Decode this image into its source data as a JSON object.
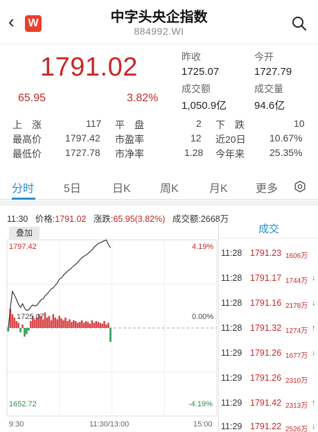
{
  "header": {
    "back_icon": "chevron-left-icon",
    "logo_text": "W",
    "title": "中字头央企指数",
    "code": "884992.WI",
    "search_icon": "search-icon"
  },
  "quote": {
    "price": "1791.02",
    "change": "65.95",
    "change_pct": "3.82%",
    "prev_close_label": "昨收",
    "prev_close": "1725.07",
    "open_label": "今开",
    "open": "1727.79",
    "turnover_label": "成交额",
    "turnover": "1,050.9亿",
    "volume_label": "成交量",
    "volume": "94.6亿"
  },
  "stats": {
    "rising_label": "上　涨",
    "rising": "117",
    "flat_label": "平　盘",
    "flat": "2",
    "falling_label": "下　跌",
    "falling": "10",
    "high_label": "最高价",
    "high": "1797.42",
    "pe_label": "市盈率",
    "pe": "12",
    "chg20_label": "近20日",
    "chg20": "10.67%",
    "low_label": "最低价",
    "low": "1727.78",
    "pb_label": "市净率",
    "pb": "1.28",
    "ytd_label": "今年来",
    "ytd": "25.35%"
  },
  "tabs": [
    {
      "label": "分时",
      "active": true
    },
    {
      "label": "5日"
    },
    {
      "label": "日K"
    },
    {
      "label": "周K"
    },
    {
      "label": "月K"
    },
    {
      "label": "更多"
    }
  ],
  "tabs_settings_icon": "settings-hexagon-icon",
  "info_line": {
    "time": "11:30",
    "price_label": "价格:",
    "price": "1791.02",
    "change_label": "涨跌:",
    "change": "65.95(3.82%)",
    "turnover_label": "成交额:",
    "turnover": "2668万"
  },
  "chart": {
    "overlay_label": "叠加",
    "max_price": "1797.42",
    "max_pct": "4.19%",
    "base_price": "1725.07",
    "base_pct": "0.00%",
    "min_price": "1652.72",
    "min_pct": "-4.19%",
    "time_start": "9:30",
    "time_mid": "11:30/13:00",
    "time_end": "15:00"
  },
  "chart_data": {
    "type": "line",
    "y_range": [
      1652.72,
      1797.42
    ],
    "baseline": 1725.07,
    "price_series": [
      1725.07,
      1741.5,
      1755.2,
      1752.0,
      1748.5,
      1744.3,
      1742.0,
      1745.0,
      1741.2,
      1739.5,
      1740.1,
      1742.6,
      1744.0,
      1743.1,
      1743.8,
      1746.0,
      1748.2,
      1749.0,
      1751.5,
      1753.0,
      1755.1,
      1757.3,
      1758.0,
      1760.2,
      1762.0,
      1765.3,
      1766.1,
      1768.5,
      1770.2,
      1771.8,
      1773.0,
      1774.6,
      1776.1,
      1777.3,
      1779.0,
      1781.2,
      1782.8,
      1784.1,
      1785.0,
      1786.2,
      1788.0,
      1789.3,
      1791.5,
      1793.0,
      1794.6,
      1795.1,
      1796.0,
      1796.8,
      1797.42,
      1793.5,
      1791.02
    ],
    "volume_bars": [
      -4,
      22,
      16,
      12,
      8,
      6,
      -5,
      4,
      -10,
      -7,
      -3,
      8,
      14,
      10,
      12,
      16,
      14,
      10,
      18,
      12,
      14,
      9,
      16,
      12,
      10,
      14,
      11,
      9,
      12,
      8,
      10,
      7,
      9,
      8,
      6,
      7,
      9,
      6,
      8,
      7,
      5,
      9,
      6,
      8,
      7,
      6,
      5,
      8,
      4,
      6,
      -16
    ]
  },
  "trades": {
    "title": "成交",
    "rows": [
      {
        "time": "11:28",
        "price": "1791.23",
        "vol": "1606万",
        "arrow": ""
      },
      {
        "time": "11:28",
        "price": "1791.17",
        "vol": "1744万",
        "arrow": "↓"
      },
      {
        "time": "11:28",
        "price": "1791.16",
        "vol": "2178万",
        "arrow": "↓"
      },
      {
        "time": "11:28",
        "price": "1791.32",
        "vol": "1274万",
        "arrow": "↑"
      },
      {
        "time": "11:29",
        "price": "1791.26",
        "vol": "1677万",
        "arrow": "↓"
      },
      {
        "time": "11:29",
        "price": "1791.26",
        "vol": "2310万",
        "arrow": ""
      },
      {
        "time": "11:29",
        "price": "1791.42",
        "vol": "2313万",
        "arrow": "↑"
      },
      {
        "time": "11:29",
        "price": "1791.22",
        "vol": "2526万",
        "arrow": "↓"
      }
    ]
  }
}
